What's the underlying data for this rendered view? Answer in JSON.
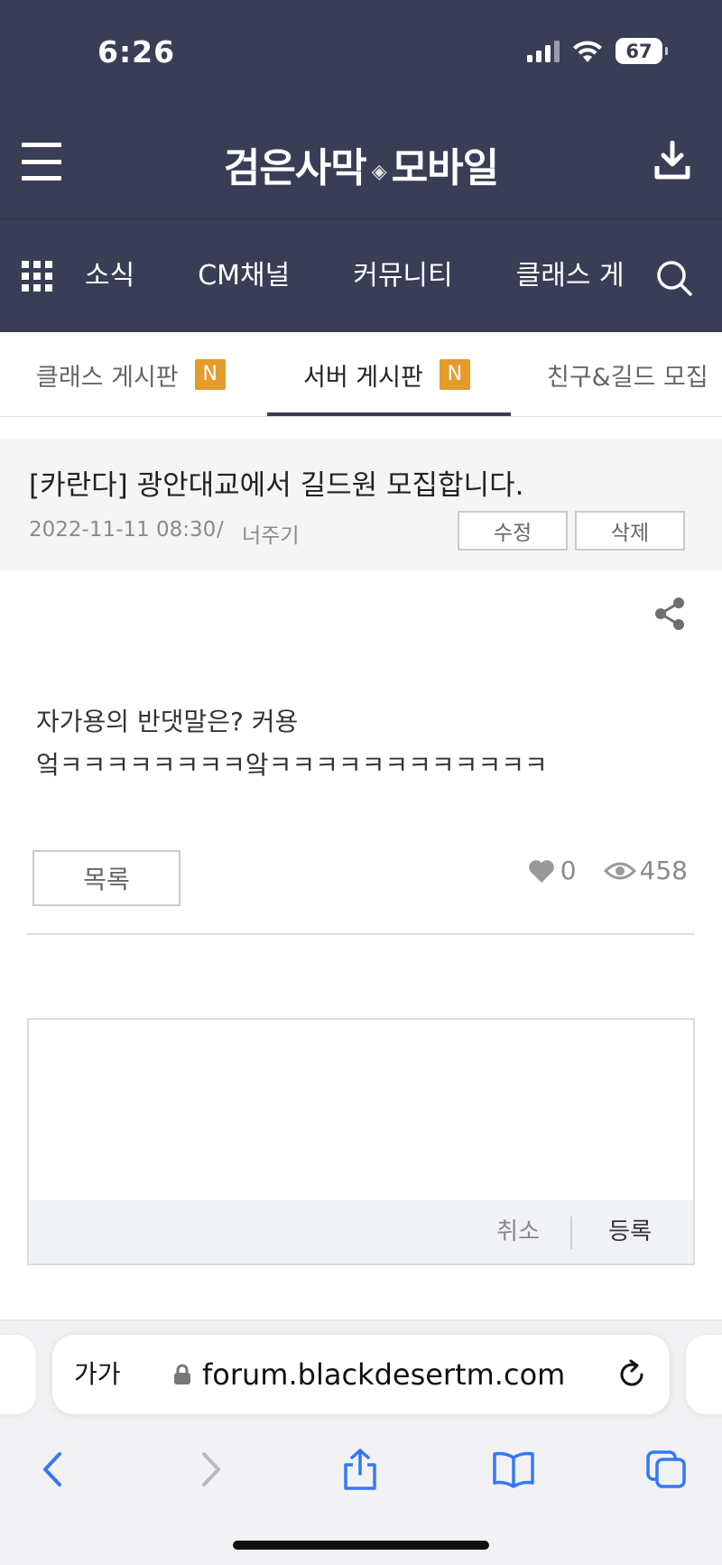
{
  "status_bar": {
    "time": "6:26",
    "battery": "67"
  },
  "header": {
    "logo_left": "검은사막",
    "logo_right": "모바일"
  },
  "nav": {
    "items": [
      "소식",
      "CM채널",
      "커뮤니티",
      "클래스 게"
    ]
  },
  "subtabs": [
    {
      "label": "클래스 게시판",
      "badge": "N"
    },
    {
      "label": "서버 게시판",
      "badge": "N"
    },
    {
      "label": "친구&길드 모집"
    }
  ],
  "post": {
    "title": "[카란다] 광안대교에서 길드원 모집합니다.",
    "date": "2022-11-11 08:30",
    "separator": "/",
    "author": "너주기",
    "edit_label": "수정",
    "delete_label": "삭제",
    "body": [
      "자가용의 반댓말은? 커용",
      "엌ㅋㅋㅋㅋㅋㅋㅋㅋ앜ㅋㅋㅋㅋㅋㅋㅋㅋㅋㅋㅋㅋ"
    ],
    "list_label": "목록",
    "likes": "0",
    "views": "458"
  },
  "comment": {
    "cancel_label": "취소",
    "submit_label": "등록"
  },
  "browser": {
    "text_size_label": "가가",
    "url": "forum.blackdesertm.com"
  },
  "colors": {
    "header_bg": "#393d55",
    "badge": "#e59a2a",
    "link_blue": "#3478f6"
  }
}
